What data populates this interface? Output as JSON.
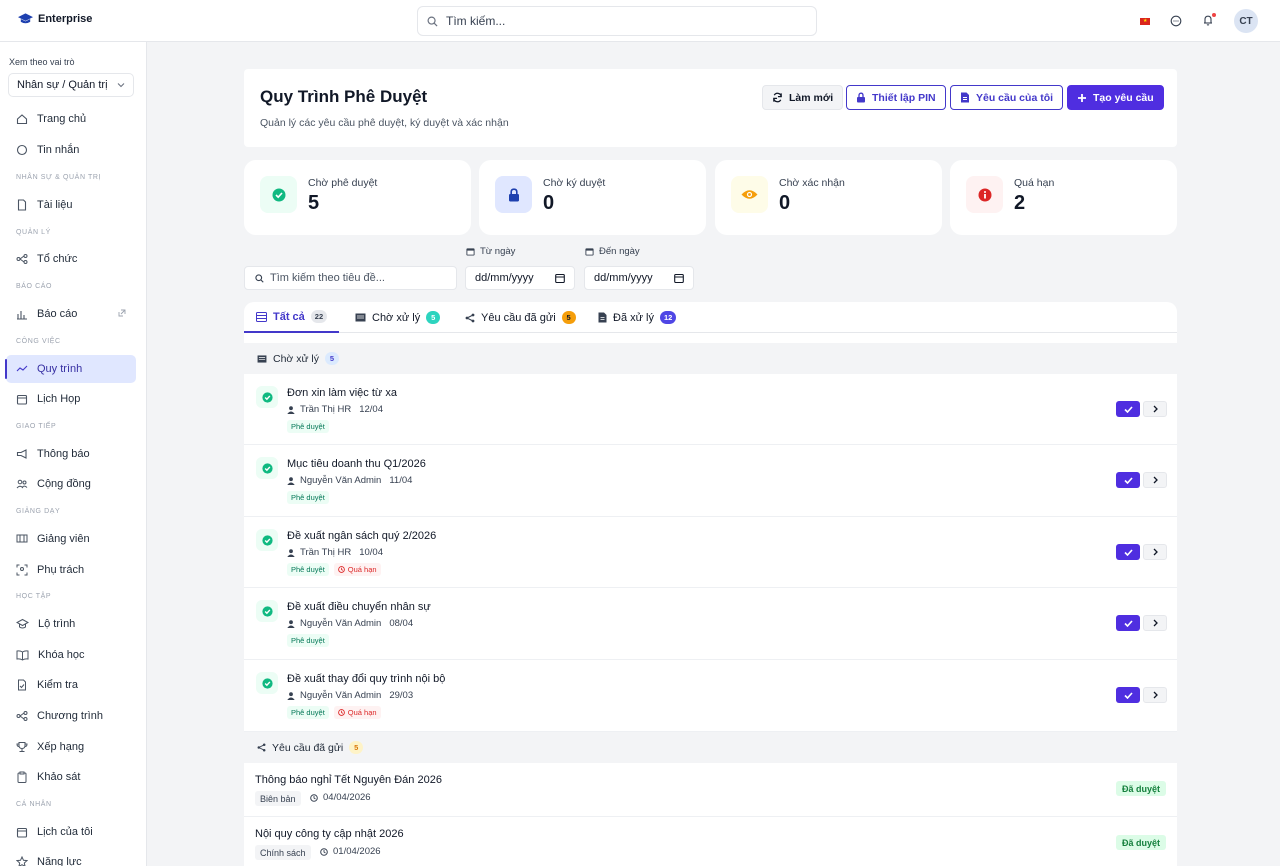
{
  "topbar": {
    "brand": "Enterprise",
    "search_placeholder": "Tìm kiếm...",
    "avatar_initials": "CT"
  },
  "sidebar": {
    "role_label": "Xem theo vai trò",
    "role_value": "Nhân sự / Quản trị",
    "items": {
      "home": "Trang chủ",
      "messages": "Tin nhắn",
      "documents": "Tài liệu",
      "organization": "Tổ chức",
      "reports": "Báo cáo",
      "workflow": "Quy trình",
      "meetings": "Lịch Họp",
      "announcements": "Thông báo",
      "community": "Cộng đồng",
      "lecturers": "Giảng viên",
      "in_charge": "Phụ trách",
      "roadmap": "Lộ trình",
      "courses": "Khóa học",
      "tests": "Kiểm tra",
      "programs": "Chương trình",
      "ranking": "Xếp hạng",
      "surveys": "Khảo sát",
      "my_calendar": "Lịch của tôi",
      "competency": "Năng lực"
    },
    "sections": {
      "hr_admin": "Nhân sự & Quản trị",
      "management": "Quản lý",
      "reports": "Báo cáo",
      "work": "Công việc",
      "communication": "Giao tiếp",
      "teaching": "Giảng dạy",
      "learning": "Học tập",
      "personal": "Cá nhân"
    }
  },
  "header": {
    "title": "Quy Trình Phê Duyệt",
    "subtitle": "Quản lý các yêu cầu phê duyệt, ký duyệt và xác nhận",
    "buttons": {
      "refresh": "Làm mới",
      "pin": "Thiết lập PIN",
      "my_requests": "Yêu cầu của tôi",
      "create": "Tạo yêu cầu"
    }
  },
  "stats": [
    {
      "label": "Chờ phê duyệt",
      "value": "5"
    },
    {
      "label": "Chờ ký duyệt",
      "value": "0"
    },
    {
      "label": "Chờ xác nhận",
      "value": "0"
    },
    {
      "label": "Quá hạn",
      "value": "2"
    }
  ],
  "filters": {
    "search_placeholder": "Tìm kiếm theo tiêu đề...",
    "from_label": "Từ ngày",
    "to_label": "Đến ngày",
    "from_value": "dd/mm/yyyy",
    "to_value": "dd/mm/yyyy"
  },
  "tabs": [
    {
      "label": "Tất cả",
      "count": "22"
    },
    {
      "label": "Chờ xử lý",
      "count": "5"
    },
    {
      "label": "Yêu cầu đã gửi",
      "count": "5"
    },
    {
      "label": "Đã xử lý",
      "count": "12"
    }
  ],
  "pending_group": {
    "label": "Chờ xử lý",
    "count": "5",
    "items": [
      {
        "title": "Đơn xin làm việc từ xa",
        "author": "Trần Thị HR",
        "date": "12/04",
        "tag": "Phê duyệt",
        "overdue": ""
      },
      {
        "title": "Mục tiêu doanh thu Q1/2026",
        "author": "Nguyễn Văn Admin",
        "date": "11/04",
        "tag": "Phê duyệt",
        "overdue": ""
      },
      {
        "title": "Đề xuất ngân sách quý 2/2026",
        "author": "Trần Thị HR",
        "date": "10/04",
        "tag": "Phê duyệt",
        "overdue": "Quá hạn"
      },
      {
        "title": "Đề xuất điều chuyển nhân sự",
        "author": "Nguyễn Văn Admin",
        "date": "08/04",
        "tag": "Phê duyệt",
        "overdue": ""
      },
      {
        "title": "Đề xuất thay đổi quy trình nội bộ",
        "author": "Nguyễn Văn Admin",
        "date": "29/03",
        "tag": "Phê duyệt",
        "overdue": "Quá hạn"
      }
    ]
  },
  "sent_group": {
    "label": "Yêu cầu đã gửi",
    "count": "5",
    "items": [
      {
        "title": "Thông báo nghỉ Tết Nguyên Đán 2026",
        "category": "Biên bản",
        "date": "04/04/2026",
        "status": "Đã duyệt"
      },
      {
        "title": "Nội quy công ty cập nhật 2026",
        "category": "Chính sách",
        "date": "01/04/2026",
        "status": "Đã duyệt"
      }
    ]
  },
  "colors": {
    "primary": "#4f2ee0",
    "accent": "#4338ca",
    "approve_green": "#10b981",
    "overdue_red": "#dc2626"
  }
}
